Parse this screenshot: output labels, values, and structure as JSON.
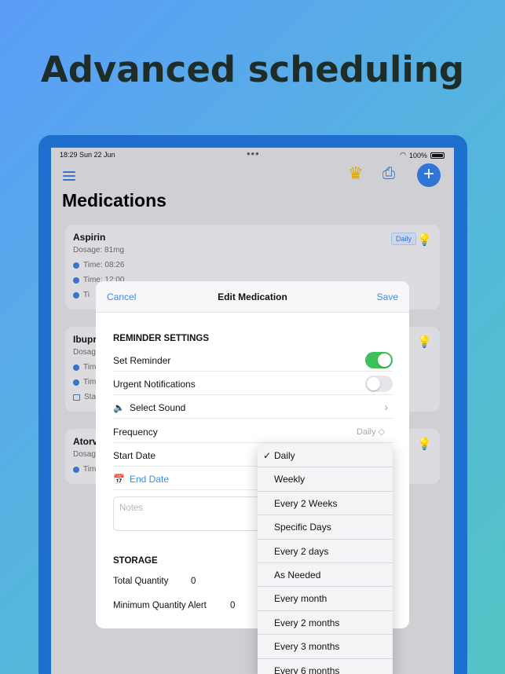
{
  "headline": "Advanced scheduling",
  "status_bar": {
    "time": "18:29  Sun 22 Jun",
    "dots": "•••",
    "battery": "100%"
  },
  "toolbar": {
    "menu_icon": "hamburger-icon",
    "crown_icon": "crown-icon",
    "printer_icon": "printer-icon",
    "add_icon": "plus-icon"
  },
  "page_title": "Medications",
  "cards": [
    {
      "name": "Aspirin",
      "dosage": "Dosage: 81mg",
      "lines": [
        "Time: 08:26",
        "Time: 12:00",
        "Ti"
      ],
      "badge": "Daily"
    },
    {
      "name": "Ibupr",
      "dosage": "Dosag",
      "lines": [
        "Tim",
        "Tim",
        "Sta"
      ]
    },
    {
      "name": "Atorv",
      "dosage": "Dosag",
      "lines": [
        "Tim"
      ]
    }
  ],
  "modal": {
    "cancel": "Cancel",
    "title": "Edit Medication",
    "save": "Save",
    "reminder_section": "REMINDER SETTINGS",
    "set_reminder": "Set Reminder",
    "set_reminder_on": true,
    "urgent": "Urgent Notifications",
    "urgent_on": false,
    "select_sound": "Select Sound",
    "frequency": "Frequency",
    "frequency_value": "Daily ◇",
    "start_date": "Start Date",
    "end_date": "End Date",
    "notes_placeholder": "Notes",
    "storage_section": "STORAGE",
    "total_quantity": "Total Quantity",
    "total_quantity_value": "0",
    "min_alert": "Minimum Quantity Alert",
    "min_alert_value": "0"
  },
  "frequency_options": {
    "selected": "Daily",
    "items": [
      "Daily",
      "Weekly",
      "Every 2 Weeks",
      "Specific Days",
      "Every 2 days",
      "As Needed",
      "Every month",
      "Every 2 months",
      "Every 3 months",
      "Every 6 months"
    ]
  },
  "colors": {
    "accent": "#3a8ee6",
    "toggle_on": "#3cc158",
    "device_frame": "#1f6fcf"
  }
}
